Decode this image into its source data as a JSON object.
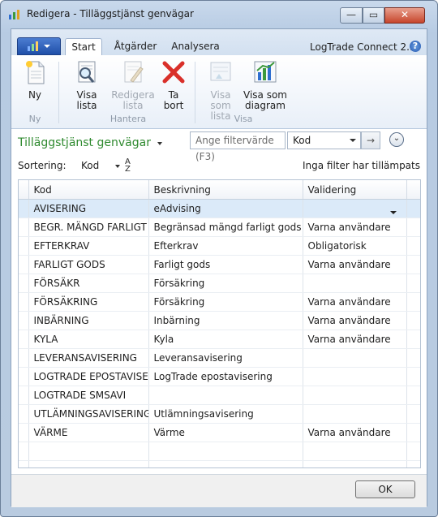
{
  "window": {
    "title": "Redigera - Tilläggstjänst genvägar",
    "minimize": "—",
    "maximize": "▭",
    "close": "✕"
  },
  "ribbon_tabs": [
    {
      "label": "Start"
    },
    {
      "label": "Åtgärder"
    },
    {
      "label": "Analysera"
    }
  ],
  "product": "LogTrade Connect 2...",
  "help": "?",
  "ribbon": {
    "new_label": "Ny",
    "group_new": "Ny",
    "view_list_label": "Visa lista",
    "edit_list_label": "Redigera lista",
    "delete_label": "Ta bort",
    "group_manage": "Hantera",
    "view_as_list_label": "Visa som lista",
    "view_as_chart_label": "Visa som diagram",
    "group_view": "Visa"
  },
  "filter": {
    "list_title": "Tilläggstjänst genvägar",
    "placeholder": "Ange filtervärde (F3)",
    "field": "Kod",
    "go": "→",
    "expand": "⌄"
  },
  "sort": {
    "label": "Sortering:",
    "field": "Kod",
    "direction": "A Z",
    "status": "Inga filter har tillämpats"
  },
  "table": {
    "columns": [
      "Kod",
      "Beskrivning",
      "Validering"
    ],
    "rows": [
      [
        "AVISERING",
        "eAdvising",
        ""
      ],
      [
        "BEGR. MÄNGD FARLIGT",
        "Begränsad mängd farligt gods",
        "Varna användare"
      ],
      [
        "EFTERKRAV",
        "Efterkrav",
        "Obligatorisk"
      ],
      [
        "FARLIGT GODS",
        "Farligt gods",
        "Varna användare"
      ],
      [
        "FÖRSÄKR",
        "Försäkring",
        ""
      ],
      [
        "FÖRSÄKRING",
        "Försäkring",
        "Varna användare"
      ],
      [
        "INBÄRNING",
        "Inbärning",
        "Varna användare"
      ],
      [
        "KYLA",
        "Kyla",
        "Varna användare"
      ],
      [
        "LEVERANSAVISERING",
        "Leveransavisering",
        ""
      ],
      [
        "LOGTRADE EPOSTAVISER",
        "LogTrade epostavisering",
        ""
      ],
      [
        "LOGTRADE SMSAVI",
        "",
        ""
      ],
      [
        "UTLÄMNINGSAVISERING",
        "Utlämningsavisering",
        ""
      ],
      [
        "VÄRME",
        "Värme",
        "Varna användare"
      ]
    ],
    "empty_rows": 2
  },
  "footer": {
    "ok_label": "OK"
  }
}
